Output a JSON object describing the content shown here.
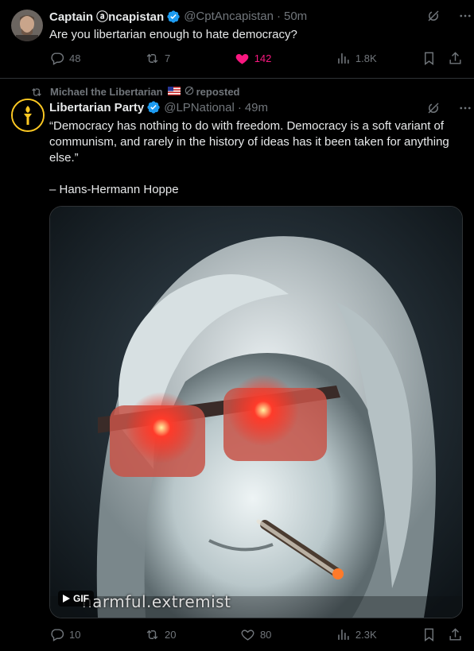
{
  "tweet1": {
    "display_name": "Captain ⓐncapistan",
    "handle": "@CptAncapistan",
    "time": "50m",
    "text": "Are you libertarian enough to hate democracy?",
    "replies": "48",
    "reposts": "7",
    "likes": "142",
    "views": "1.8K",
    "liked": true
  },
  "repost": {
    "reposter": "Michael the Libertarian",
    "suffix": "reposted"
  },
  "tweet2": {
    "display_name": "Libertarian Party",
    "handle": "@LPNational",
    "time": "49m",
    "quote": "“Democracy has nothing to do with freedom. Democracy is a soft variant of communism, and rarely in the history of ideas has it been taken for anything else.”",
    "attribution": "– Hans-Hermann Hoppe",
    "media": {
      "type": "gif",
      "badge": "GIF",
      "watermark": "harmful.extremist"
    },
    "replies": "10",
    "reposts": "20",
    "likes": "80",
    "views": "2.3K"
  },
  "colors": {
    "background": "#000000",
    "text": "#e7e9ea",
    "muted": "#71767b",
    "verified": "#1d9bf0",
    "like_active": "#f91880",
    "divider": "#2f3336",
    "lp_gold": "#fec923"
  },
  "icons": [
    "grok-icon",
    "more-icon",
    "reply-icon",
    "repost-icon",
    "like-icon",
    "views-icon",
    "bookmark-icon",
    "share-icon",
    "verified-icon"
  ]
}
